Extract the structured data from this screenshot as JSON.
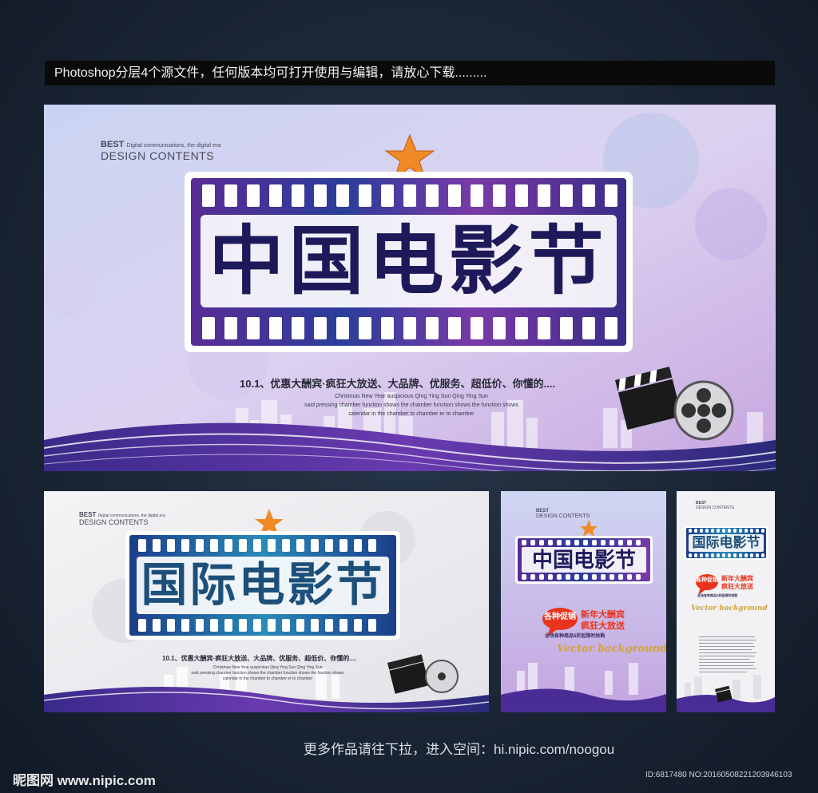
{
  "header_text": "Photoshop分层4个源文件，任何版本均可打开使用与编辑，请放心下载.........",
  "main_banner": {
    "title": "中国电影节",
    "best_line1": "BEST",
    "best_line1b": "Digital communications, the digital era",
    "best_line2": "DESIGN CONTENTS",
    "slogan": "10.1、优惠大酬宾·疯狂大放送、大品牌、优服务、超低价、你懂的....",
    "sub1": "Christmas New Year auspicious Qing Ying Sun Qing Ying Sun",
    "sub2": "said pressing chamber function shows the chamber function shows the function shows",
    "sub3": "calendar in the chamber to chamber er to chamber"
  },
  "second_banner": {
    "title": "国际电影节",
    "best_line1": "BEST",
    "best_line1b": "Digital communications, the digital era",
    "best_line2": "DESIGN CONTENTS",
    "slogan": "10.1、优惠大酬宾·疯狂大放送、大品牌、优服务、超低价、你懂的....",
    "sub1": "Christmas New Year auspicious Qing Ying Sun Qing Ying Sun",
    "sub2": "said pressing chamber function shows the chamber function shows the function shows",
    "sub3": "calendar in the chamber to chamber er to chamber"
  },
  "poster_one": {
    "title": "中国电影节",
    "best_line1": "BEST",
    "best_line2": "DESIGN CONTENTS",
    "badge": "各种促销",
    "promo1": "新年大酬宾",
    "promo2": "疯狂大放送",
    "fine": "全场各种商品5折起限时抢购",
    "script": "Vector background"
  },
  "poster_two": {
    "title": "国际电影节",
    "best_line1": "BEST",
    "best_line2": "DESIGN CONTENTS",
    "badge": "各种促销",
    "promo1": "新年大酬宾",
    "promo2": "疯狂大放送",
    "fine": "全场各种商品5折起限时抢购",
    "script": "Vector background"
  },
  "footer_link": "更多作品请往下拉，进入空间：hi.nipic.com/noogou",
  "logo_text": "昵图网 www.nipic.com",
  "ident_text": "ID:6817480 NO:20160508221203946103",
  "colors": {
    "page_bg": "#1b2636",
    "film_purple": "#5a3fa0",
    "film_blue": "#2b7fb8",
    "title_navy": "#1e1a5a",
    "title_teal": "#1c4f7a",
    "star_orange": "#f08a24",
    "badge_red": "#e8341c",
    "promo_yellow": "#ffd21a"
  },
  "icons": [
    "star-icon",
    "clapperboard-icon",
    "film-reel-icon",
    "city-skyline",
    "wave-stripes"
  ]
}
